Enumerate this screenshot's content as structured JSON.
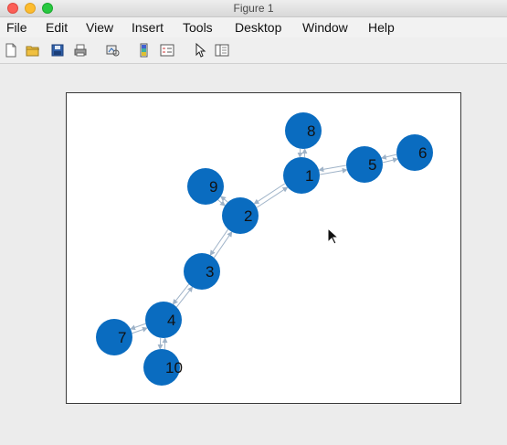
{
  "window": {
    "title": "Figure 1"
  },
  "menu": [
    "File",
    "Edit",
    "View",
    "Insert",
    "Tools",
    "Desktop",
    "Window",
    "Help"
  ],
  "toolbar": [
    "new-figure-icon",
    "open-file-icon",
    "save-icon",
    "print-icon",
    "link-plot-icon",
    "insert-colorbar-icon",
    "insert-legend-icon",
    "edit-plot-cursor-icon",
    "property-inspector-icon"
  ],
  "graph": {
    "node_color": "#0a6cc0",
    "edge_color": "#9fb3c8",
    "nodes": [
      {
        "id": "1",
        "label": "1"
      },
      {
        "id": "2",
        "label": "2"
      },
      {
        "id": "3",
        "label": "3"
      },
      {
        "id": "4",
        "label": "4"
      },
      {
        "id": "5",
        "label": "5"
      },
      {
        "id": "6",
        "label": "6"
      },
      {
        "id": "7",
        "label": "7"
      },
      {
        "id": "8",
        "label": "8"
      },
      {
        "id": "9",
        "label": "9"
      },
      {
        "id": "10",
        "label": "10"
      }
    ],
    "edges": [
      [
        "1",
        "2"
      ],
      [
        "1",
        "5"
      ],
      [
        "1",
        "8"
      ],
      [
        "5",
        "6"
      ],
      [
        "2",
        "3"
      ],
      [
        "2",
        "9"
      ],
      [
        "3",
        "4"
      ],
      [
        "4",
        "7"
      ],
      [
        "4",
        "10"
      ]
    ]
  }
}
